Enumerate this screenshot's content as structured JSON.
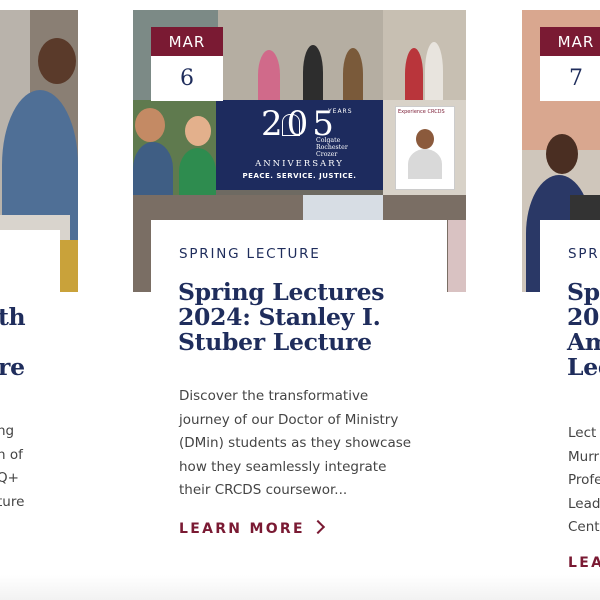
{
  "cards": [
    {
      "month": "",
      "day": "",
      "category": "",
      "title_lines": [
        "th",
        "re"
      ],
      "desc_lines": [
        "ng",
        "n of",
        "Q+",
        "ture"
      ],
      "more_label": ""
    },
    {
      "month": "MAR",
      "day": "6",
      "category": "SPRING LECTURE",
      "title_lines": [
        "Spring Lectures",
        "2024: Stanley I.",
        "Stuber Lecture"
      ],
      "desc_lines": [
        "Discover the transformative",
        "journey of our Doctor of Ministry",
        "(DMin) students as they showcase",
        "how they seamlessly integrate",
        "their CRCDS coursewor..."
      ],
      "more_label": "LEARN MORE",
      "logo": {
        "number": "205",
        "years": "YEARS",
        "school_lines": [
          "Colgate",
          "Rochester",
          "Crozer"
        ],
        "anniversary": "ANNIVERSARY",
        "tagline": "PEACE. SERVICE. JUSTICE."
      },
      "frame_text": "Experience CRCDS"
    },
    {
      "month": "MAR",
      "day": "7",
      "category": "SPR",
      "title_lines": [
        "Spr",
        "202",
        "Am",
        "Lec"
      ],
      "desc_lines": [
        "Lect",
        "Murr",
        "Profe",
        "Lead",
        "Cent"
      ],
      "more_label": "LEA"
    }
  ],
  "colors": {
    "navy": "#1f2d5c",
    "maroon": "#7a1a33",
    "body_text": "#444444"
  }
}
